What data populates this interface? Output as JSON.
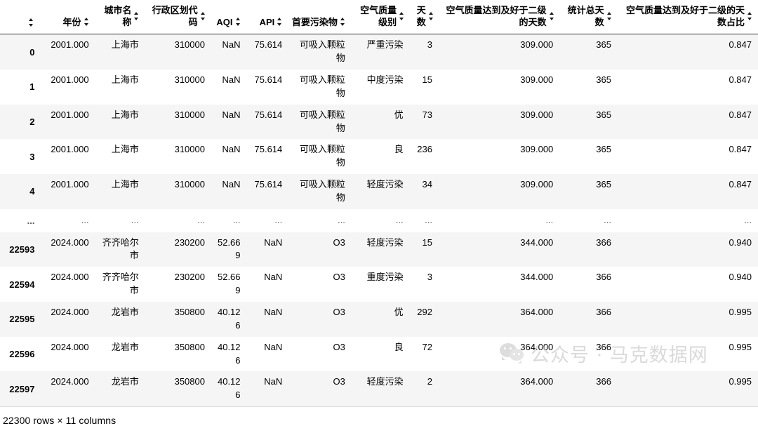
{
  "table": {
    "index_header": "",
    "columns": [
      {
        "key": "year",
        "label": "年份"
      },
      {
        "key": "city",
        "label": "城市名称"
      },
      {
        "key": "code",
        "label": "行政区划代码"
      },
      {
        "key": "aqi",
        "label": "AQI"
      },
      {
        "key": "api",
        "label": "API"
      },
      {
        "key": "poll",
        "label": "首要污染物"
      },
      {
        "key": "level",
        "label": "空气质量级别"
      },
      {
        "key": "days",
        "label": "天数"
      },
      {
        "key": "good",
        "label": "空气质量达到及好于二级的天数"
      },
      {
        "key": "total",
        "label": "统计总天数"
      },
      {
        "key": "ratio",
        "label": "空气质量达到及好于二级的天数占比"
      }
    ],
    "rows": [
      {
        "index": "0",
        "year": "2001.000",
        "city": "上海市",
        "code": "310000",
        "aqi": "NaN",
        "api": "75.614",
        "poll": "可吸入颗粒物",
        "level": "严重污染",
        "days": "3",
        "good": "309.000",
        "total": "365",
        "ratio": "0.847"
      },
      {
        "index": "1",
        "year": "2001.000",
        "city": "上海市",
        "code": "310000",
        "aqi": "NaN",
        "api": "75.614",
        "poll": "可吸入颗粒物",
        "level": "中度污染",
        "days": "15",
        "good": "309.000",
        "total": "365",
        "ratio": "0.847"
      },
      {
        "index": "2",
        "year": "2001.000",
        "city": "上海市",
        "code": "310000",
        "aqi": "NaN",
        "api": "75.614",
        "poll": "可吸入颗粒物",
        "level": "优",
        "days": "73",
        "good": "309.000",
        "total": "365",
        "ratio": "0.847"
      },
      {
        "index": "3",
        "year": "2001.000",
        "city": "上海市",
        "code": "310000",
        "aqi": "NaN",
        "api": "75.614",
        "poll": "可吸入颗粒物",
        "level": "良",
        "days": "236",
        "good": "309.000",
        "total": "365",
        "ratio": "0.847"
      },
      {
        "index": "4",
        "year": "2001.000",
        "city": "上海市",
        "code": "310000",
        "aqi": "NaN",
        "api": "75.614",
        "poll": "可吸入颗粒物",
        "level": "轻度污染",
        "days": "34",
        "good": "309.000",
        "total": "365",
        "ratio": "0.847"
      },
      {
        "index": "...",
        "year": "...",
        "city": "...",
        "code": "...",
        "aqi": "...",
        "api": "...",
        "poll": "...",
        "level": "...",
        "days": "...",
        "good": "...",
        "total": "...",
        "ratio": "...",
        "is_ellipsis": true
      },
      {
        "index": "22593",
        "year": "2024.000",
        "city": "齐齐哈尔市",
        "code": "230200",
        "aqi": "52.669",
        "api": "NaN",
        "poll": "O3",
        "level": "轻度污染",
        "days": "15",
        "good": "344.000",
        "total": "366",
        "ratio": "0.940"
      },
      {
        "index": "22594",
        "year": "2024.000",
        "city": "齐齐哈尔市",
        "code": "230200",
        "aqi": "52.669",
        "api": "NaN",
        "poll": "O3",
        "level": "重度污染",
        "days": "3",
        "good": "344.000",
        "total": "366",
        "ratio": "0.940"
      },
      {
        "index": "22595",
        "year": "2024.000",
        "city": "龙岩市",
        "code": "350800",
        "aqi": "40.126",
        "api": "NaN",
        "poll": "O3",
        "level": "优",
        "days": "292",
        "good": "364.000",
        "total": "366",
        "ratio": "0.995"
      },
      {
        "index": "22596",
        "year": "2024.000",
        "city": "龙岩市",
        "code": "350800",
        "aqi": "40.126",
        "api": "NaN",
        "poll": "O3",
        "level": "良",
        "days": "72",
        "good": "364.000",
        "total": "366",
        "ratio": "0.995"
      },
      {
        "index": "22597",
        "year": "2024.000",
        "city": "龙岩市",
        "code": "350800",
        "aqi": "40.126",
        "api": "NaN",
        "poll": "O3",
        "level": "轻度污染",
        "days": "2",
        "good": "364.000",
        "total": "366",
        "ratio": "0.995"
      }
    ],
    "shape_text": "22300 rows × 11 columns"
  },
  "watermark": {
    "text": "公众号 · 马克数据网",
    "icon": "wechat-icon",
    "color": "#c4c4c4"
  }
}
